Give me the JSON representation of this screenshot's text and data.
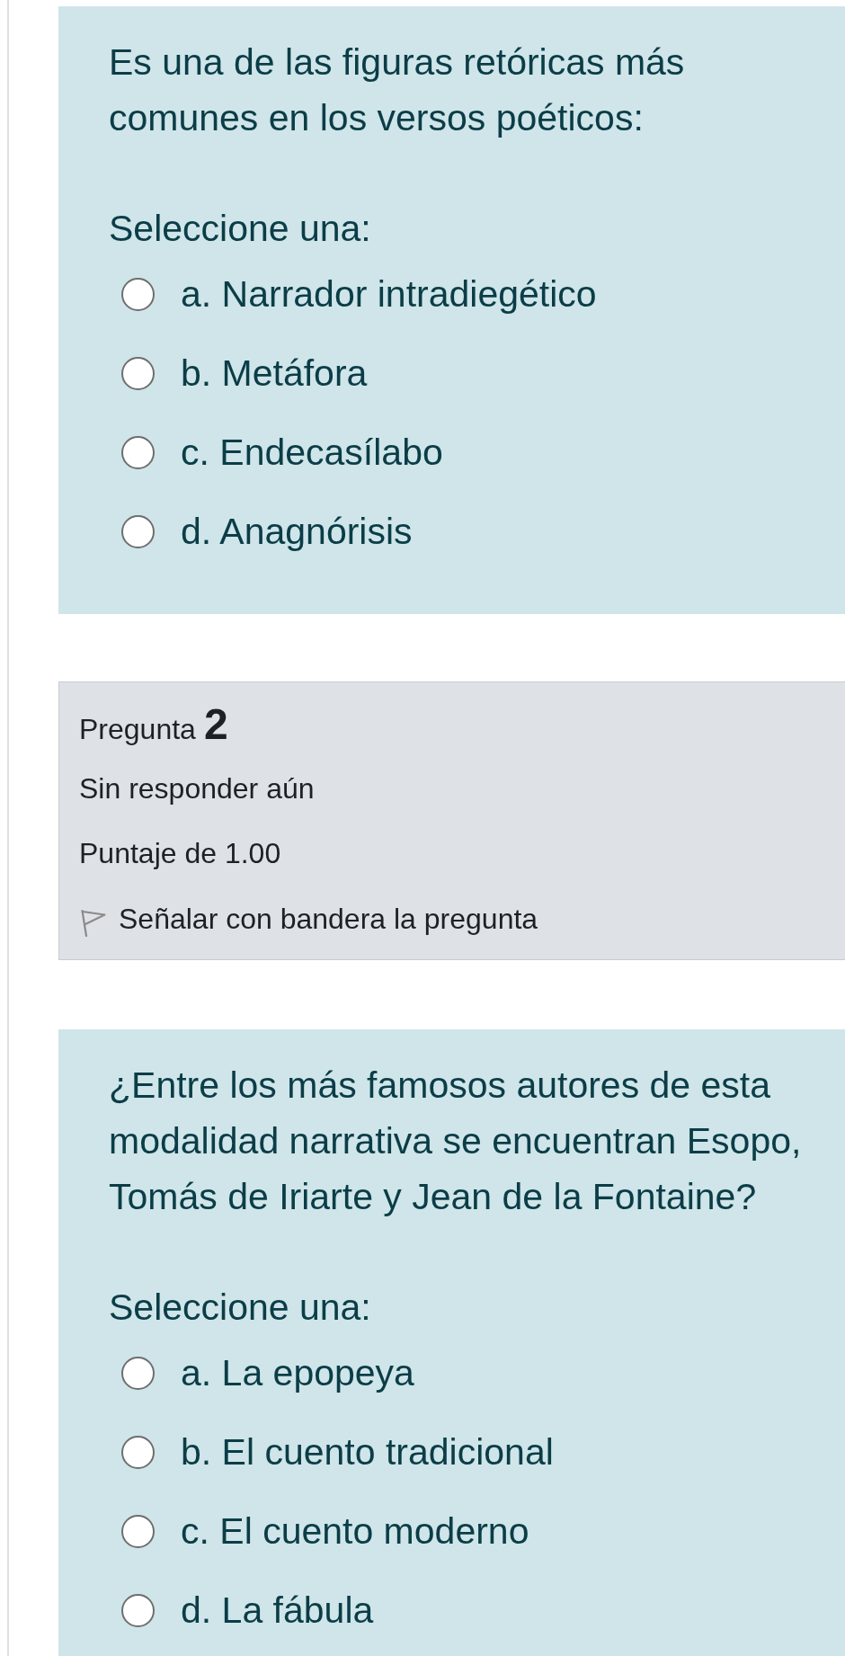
{
  "question_1": {
    "text": "Es una de las figuras retóricas más comunes en los versos poéticos:",
    "prompt": "Seleccione una:",
    "options": [
      {
        "label": "a. Narrador intradiegético",
        "selected": false
      },
      {
        "label": "b. Metáfora",
        "selected": false
      },
      {
        "label": "c. Endecasílabo",
        "selected": false
      },
      {
        "label": "d. Anagnórisis",
        "selected": false
      }
    ]
  },
  "question_2": {
    "info": {
      "title": "Pregunta",
      "number": "2",
      "status": "Sin responder aún",
      "score": "Puntaje de 1.00",
      "flag": {
        "label": "Señalar con bandera la pregunta",
        "flagged": false
      }
    },
    "text": "¿Entre los más famosos autores de esta modalidad narrativa se encuentran Esopo, Tomás de Iriarte y Jean de la Fontaine?",
    "prompt": "Seleccione una:",
    "options": [
      {
        "label": "a. La epopeya",
        "selected": false
      },
      {
        "label": "b. El cuento tradicional",
        "selected": false
      },
      {
        "label": "c. El cuento moderno",
        "selected": false
      },
      {
        "label": "d. La fábula",
        "selected": false
      }
    ]
  }
}
